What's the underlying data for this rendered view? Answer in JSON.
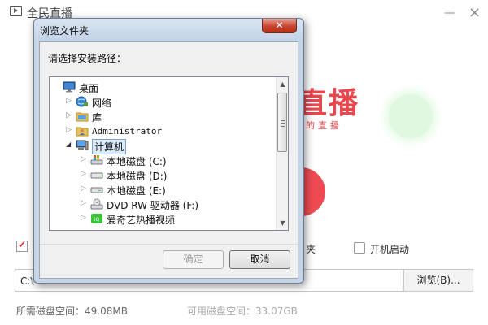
{
  "app": {
    "title": "全民直播",
    "brand_title": "直播",
    "brand_slogan": "的直播",
    "shortcut_label_tail": "夹",
    "startup_label": "开机启动",
    "path_prefix": "C:\\",
    "browse_label": "浏览(B)...",
    "required_space": "所需磁盘空间：49.08MB",
    "available_space": "可用磁盘空间：33.07GB",
    "colors": {
      "brand": "#e8474d",
      "accent_green": "#dff8df"
    }
  },
  "dialog": {
    "title": "浏览文件夹",
    "prompt": "请选择安装路径：",
    "ok_label": "确定",
    "cancel_label": "取消",
    "tree": [
      {
        "label": "桌面",
        "icon": "desktop-icon",
        "level": 0,
        "expander": ""
      },
      {
        "label": "网络",
        "icon": "network-icon",
        "level": 1,
        "expander": "collapsed"
      },
      {
        "label": "库",
        "icon": "library-icon",
        "level": 1,
        "expander": "collapsed"
      },
      {
        "label": "Administrator",
        "icon": "user-folder-icon",
        "level": 1,
        "expander": "collapsed",
        "mono": true
      },
      {
        "label": "计算机",
        "icon": "computer-icon",
        "level": 1,
        "expander": "expanded",
        "selected": true
      },
      {
        "label": "本地磁盘 (C:)",
        "icon": "system-drive-icon",
        "level": 2,
        "expander": "collapsed"
      },
      {
        "label": "本地磁盘 (D:)",
        "icon": "drive-icon",
        "level": 2,
        "expander": "collapsed"
      },
      {
        "label": "本地磁盘 (E:)",
        "icon": "drive-icon",
        "level": 2,
        "expander": "collapsed"
      },
      {
        "label": "DVD RW 驱动器 (F:)",
        "icon": "dvd-drive-icon",
        "level": 2,
        "expander": "collapsed"
      },
      {
        "label": "爱奇艺热播视频",
        "icon": "iqiyi-icon",
        "level": 2,
        "expander": "collapsed"
      }
    ]
  }
}
